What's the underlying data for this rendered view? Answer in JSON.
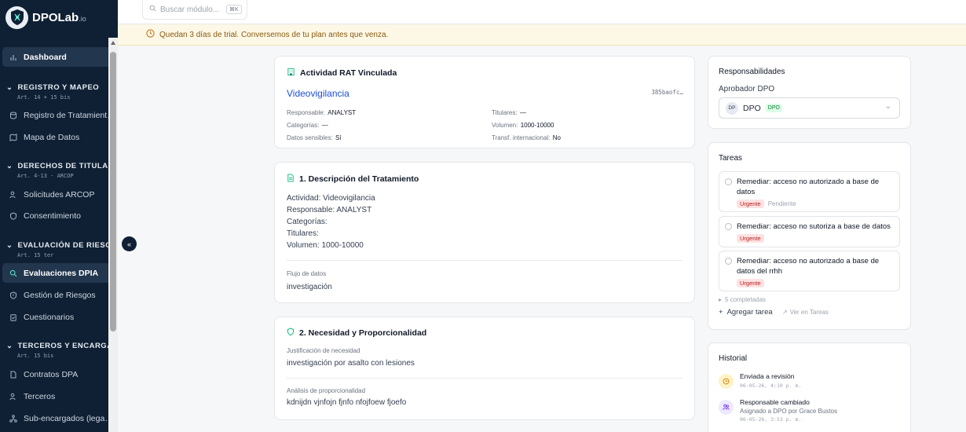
{
  "app": {
    "name": "DPOLab",
    "suffix": ".io"
  },
  "search": {
    "placeholder": "Buscar módulo...",
    "shortcut": "⌘K"
  },
  "trial": {
    "message": "Quedan 3 días de trial. Conversemos de tu plan antes que venza."
  },
  "sidebar": {
    "dashboard": "Dashboard",
    "sections": [
      {
        "title": "REGISTRO Y MAPEO",
        "sub": "Art. 14 + 15 bis",
        "items": [
          "Registro de Tratamient…",
          "Mapa de Datos"
        ]
      },
      {
        "title": "DERECHOS DE TITULAR…",
        "sub": "Art. 4-13 · ARCOP",
        "items": [
          "Solicitudes ARCOP",
          "Consentimiento"
        ]
      },
      {
        "title": "EVALUACIÓN DE RIESGO",
        "sub": "Art. 15 ter",
        "items": [
          "Evaluaciones DPIA",
          "Gestión de Riesgos",
          "Cuestionarios"
        ]
      },
      {
        "title": "TERCEROS Y ENCARGA…",
        "sub": "Art. 15 bis",
        "items": [
          "Contratos DPA",
          "Terceros",
          "Sub-encargados (lega…"
        ]
      }
    ]
  },
  "rat": {
    "title": "Actividad RAT Vinculada",
    "activity": "Videovigilancia",
    "hash": "385baofc…",
    "fields": {
      "responsable_label": "Responsable:",
      "responsable": "ANALYST",
      "titulares_label": "Titulares:",
      "titulares": "—",
      "categorias_label": "Categorías:",
      "categorias": "—",
      "volumen_label": "Volumen:",
      "volumen": "1000-10000",
      "sensibles_label": "Datos sensibles:",
      "sensibles": "Sí",
      "transf_label": "Transf. internacional:",
      "transf": "No"
    }
  },
  "descripcion": {
    "title": "1. Descripción del Tratamiento",
    "lines": [
      "Actividad: Videovigilancia",
      "Responsable: ANALYST",
      "Categorías:",
      "Titulares:",
      "Volumen: 1000-10000"
    ],
    "flujo_label": "Flujo de datos",
    "flujo": "investigación"
  },
  "necesidad": {
    "title": "2. Necesidad y Proporcionalidad",
    "just_label": "Justificación de necesidad",
    "just": "investigación por asalto con lesiones",
    "prop_label": "Análisis de proporcionalidad",
    "prop": "kdnijdn vjnfojn fjnfo nfojfoew fjoefo"
  },
  "responsabilidades": {
    "title": "Responsabilidades",
    "label": "Aprobador DPO",
    "avatar": "DP",
    "name": "DPO",
    "tag": "DPO"
  },
  "tareas": {
    "title": "Tareas",
    "items": [
      {
        "text": "Remediar: acceso no autorizado a base de datos",
        "badge": "Urgente",
        "status": "Pendiente"
      },
      {
        "text": "Remediar: acceso no sutoriza a base de datos",
        "badge": "Urgente",
        "status": ""
      },
      {
        "text": "Remediar: acceso no autorizado a base de datos del rrhh",
        "badge": "Urgente",
        "status": ""
      }
    ],
    "completed": "5 completadas",
    "add": "Agregar tarea",
    "view": "Ver en Tareas"
  },
  "historial": {
    "title": "Historial",
    "items": [
      {
        "title": "Enviada a revisión",
        "sub": "",
        "date": "06-05-26, 4:10 p. m."
      },
      {
        "title": "Responsable cambiado",
        "sub": "Asignado a DPO por Grace Bustos",
        "date": "06-05-26, 3:53 p. m."
      }
    ]
  },
  "colors": {
    "sidebar": "#0f2034",
    "accent": "#1d4ed8",
    "urgent": "#b91c1c"
  }
}
